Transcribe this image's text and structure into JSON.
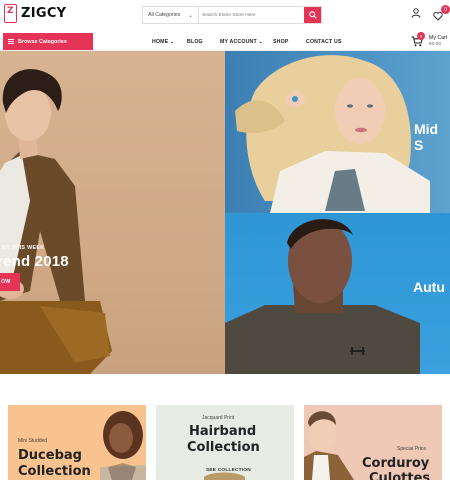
{
  "header": {
    "logo_text": "ZIGCY",
    "search": {
      "category": "All Categories",
      "placeholder": "Search Entire Store Here"
    },
    "wishlist_count": "0"
  },
  "nav": {
    "browse_label": "Browse Categories",
    "menu": [
      "HOME",
      "BLOG",
      "MY ACCOUNT",
      "SHOP",
      "CONTACT US"
    ],
    "cart": {
      "count": "0",
      "label": "My Cart",
      "price": "€0.00"
    }
  },
  "hero": {
    "left": {
      "subtitle": "NY THIS WEEK",
      "title": "rend 2018",
      "button": "OW"
    },
    "top_right": {
      "title": "Mid S"
    },
    "bottom_right": {
      "title": "Autu"
    }
  },
  "banners": [
    {
      "small": "Mini Studded",
      "title_line1": "Ducebag",
      "title_line2": "Collection"
    },
    {
      "small": "Jacquard Print",
      "title_line1": "Hairband",
      "title_line2": "Collection",
      "link": "SEE COLLECTION"
    },
    {
      "small": "Special Price",
      "title_line1": "Corduroy",
      "title_line2": "Culottes"
    }
  ],
  "colors": {
    "accent": "#e53455",
    "banner1": "#f9c38f",
    "banner2": "#e6ece3",
    "banner3": "#efc9b5"
  },
  "icons": [
    "search-icon",
    "user-icon",
    "heart-icon",
    "cart-icon",
    "menu-icon",
    "chevron-down-icon"
  ]
}
